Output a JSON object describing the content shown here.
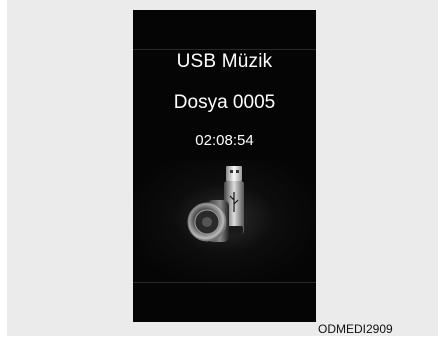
{
  "screen": {
    "title": "USB Müzik",
    "file_name": "Dosya 0005",
    "play_time": "02:08:54",
    "icon": "usb-speaker-icon"
  },
  "caption": "ODMEDI2909",
  "colors": {
    "screen_background": "#050505",
    "frame_background": "#ebebeb",
    "text": "#ffffff"
  }
}
